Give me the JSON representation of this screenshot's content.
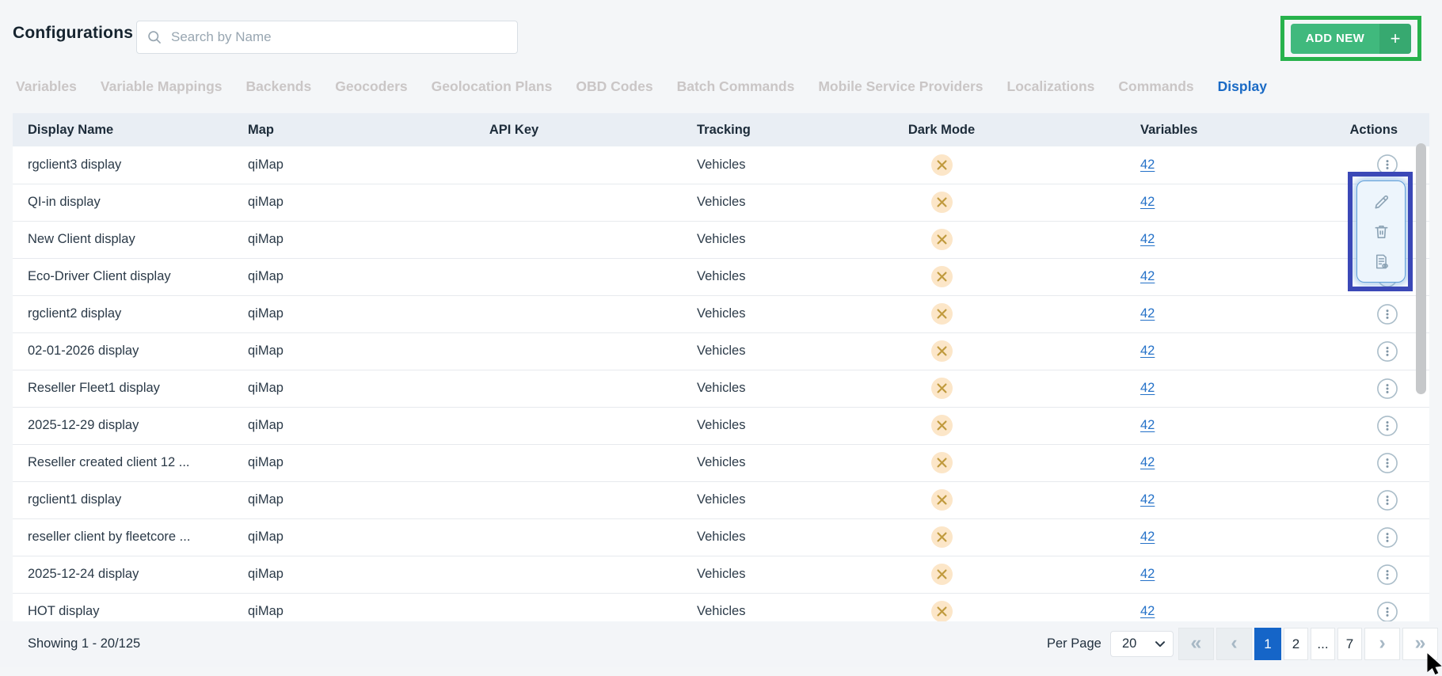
{
  "header": {
    "title": "Configurations",
    "search_placeholder": "Search by Name",
    "add_new_label": "ADD NEW",
    "add_new_plus_glyph": "+"
  },
  "tabs": [
    {
      "label": "Variables",
      "active": false
    },
    {
      "label": "Variable Mappings",
      "active": false
    },
    {
      "label": "Backends",
      "active": false
    },
    {
      "label": "Geocoders",
      "active": false
    },
    {
      "label": "Geolocation Plans",
      "active": false
    },
    {
      "label": "OBD Codes",
      "active": false
    },
    {
      "label": "Batch Commands",
      "active": false
    },
    {
      "label": "Mobile Service Providers",
      "active": false
    },
    {
      "label": "Localizations",
      "active": false
    },
    {
      "label": "Commands",
      "active": false
    },
    {
      "label": "Display",
      "active": true
    }
  ],
  "table": {
    "columns": [
      "Display Name",
      "Map",
      "API Key",
      "Tracking",
      "Dark Mode",
      "Variables",
      "Actions"
    ],
    "rows": [
      {
        "display_name": "rgclient3 display",
        "map": "qiMap",
        "api_key": "",
        "tracking": "Vehicles",
        "dark_mode": "off",
        "variables": "42"
      },
      {
        "display_name": "QI-in display",
        "map": "qiMap",
        "api_key": "",
        "tracking": "Vehicles",
        "dark_mode": "off",
        "variables": "42"
      },
      {
        "display_name": "New Client display",
        "map": "qiMap",
        "api_key": "",
        "tracking": "Vehicles",
        "dark_mode": "off",
        "variables": "42"
      },
      {
        "display_name": "Eco-Driver Client display",
        "map": "qiMap",
        "api_key": "",
        "tracking": "Vehicles",
        "dark_mode": "off",
        "variables": "42"
      },
      {
        "display_name": "rgclient2 display",
        "map": "qiMap",
        "api_key": "",
        "tracking": "Vehicles",
        "dark_mode": "off",
        "variables": "42"
      },
      {
        "display_name": "02-01-2026 display",
        "map": "qiMap",
        "api_key": "",
        "tracking": "Vehicles",
        "dark_mode": "off",
        "variables": "42"
      },
      {
        "display_name": "Reseller Fleet1 display",
        "map": "qiMap",
        "api_key": "",
        "tracking": "Vehicles",
        "dark_mode": "off",
        "variables": "42"
      },
      {
        "display_name": "2025-12-29 display",
        "map": "qiMap",
        "api_key": "",
        "tracking": "Vehicles",
        "dark_mode": "off",
        "variables": "42"
      },
      {
        "display_name": "Reseller created client 12 ...",
        "map": "qiMap",
        "api_key": "",
        "tracking": "Vehicles",
        "dark_mode": "off",
        "variables": "42"
      },
      {
        "display_name": "rgclient1 display",
        "map": "qiMap",
        "api_key": "",
        "tracking": "Vehicles",
        "dark_mode": "off",
        "variables": "42"
      },
      {
        "display_name": "reseller client by fleetcore ...",
        "map": "qiMap",
        "api_key": "",
        "tracking": "Vehicles",
        "dark_mode": "off",
        "variables": "42"
      },
      {
        "display_name": "2025-12-24 display",
        "map": "qiMap",
        "api_key": "",
        "tracking": "Vehicles",
        "dark_mode": "off",
        "variables": "42"
      },
      {
        "display_name": "HOT display",
        "map": "qiMap",
        "api_key": "",
        "tracking": "Vehicles",
        "dark_mode": "off",
        "variables": "42"
      }
    ]
  },
  "actions_menu": {
    "items": [
      "edit",
      "delete",
      "view-details"
    ]
  },
  "footer": {
    "showing": "Showing 1 - 20/125",
    "per_page_label": "Per Page",
    "per_page_value": "20",
    "pagination": {
      "first_glyph": "«",
      "prev_glyph": "‹",
      "next_glyph": "›",
      "last_glyph": "»",
      "pages": [
        {
          "label": "1",
          "active": true
        },
        {
          "label": "2",
          "active": false
        },
        {
          "label": "...",
          "active": false
        },
        {
          "label": "7",
          "active": false
        }
      ]
    }
  },
  "colors": {
    "add_new_green": "#40b97d",
    "annotation_green": "#27b24c",
    "annotation_indigo": "#3b48b7",
    "active_tab_blue": "#1a6ac5",
    "link_blue": "#2471c8",
    "active_page_blue": "#1565c8",
    "dark_mode_circle": "#fce6c8",
    "dark_mode_x": "#c09a3e",
    "table_header_bg": "#e9eef4"
  }
}
